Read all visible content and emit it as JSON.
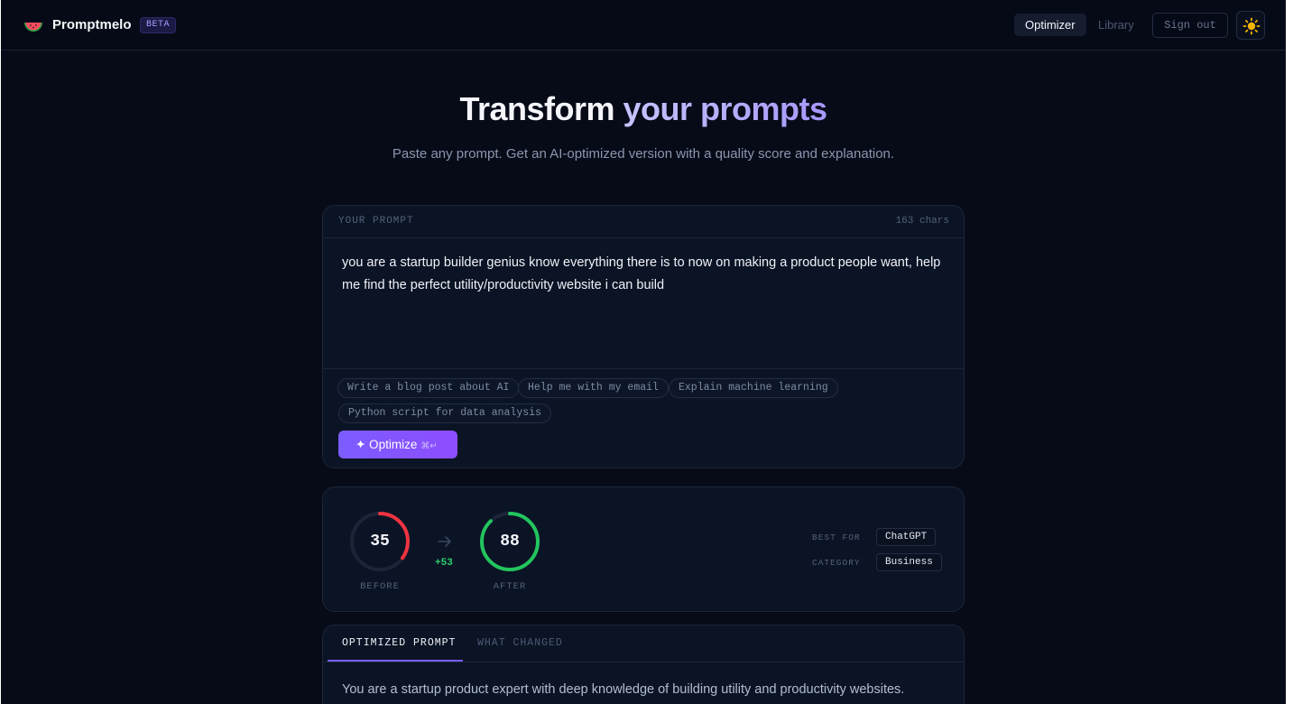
{
  "header": {
    "brand": "Promptmelo",
    "badge": "BETA",
    "logo_icon": "watermelon-icon",
    "nav": {
      "optimizer": "Optimizer",
      "library": "Library"
    },
    "sign_out": "Sign out",
    "theme_icon": "sun-icon"
  },
  "hero": {
    "title_plain": "Transform ",
    "title_accent": "your prompts",
    "subtitle": "Paste any prompt. Get an AI-optimized version with a quality score and explanation."
  },
  "prompt": {
    "label": "YOUR PROMPT",
    "char_count": "163 chars",
    "text": "you are a startup builder genius know everything there is to now on making a product people want, help me find the perfect utility/productivity website i can build",
    "suggestions": [
      "Write a blog post about AI",
      "Help me with my email",
      "Explain machine learning",
      "Python script for data analysis"
    ],
    "optimize_label": "✦ Optimize",
    "optimize_shortcut": "⌘↵"
  },
  "score": {
    "before_value": "35",
    "before_label": "BEFORE",
    "before_fraction": 0.35,
    "after_value": "88",
    "after_label": "AFTER",
    "after_fraction": 0.88,
    "delta": "+53",
    "best_for_label": "BEST FOR",
    "best_for_value": "ChatGPT",
    "category_label": "CATEGORY",
    "category_value": "Business",
    "colors": {
      "before": "#ef3340",
      "after": "#22c55e",
      "track": "#1c2438"
    }
  },
  "output": {
    "tabs": [
      "OPTIMIZED PROMPT",
      "WHAT CHANGED"
    ],
    "text": "You are a startup product expert with deep knowledge of building utility and productivity websites."
  },
  "colors": {
    "accent": "#7c5cff",
    "background": "#070b18",
    "card": "#0b1425"
  }
}
